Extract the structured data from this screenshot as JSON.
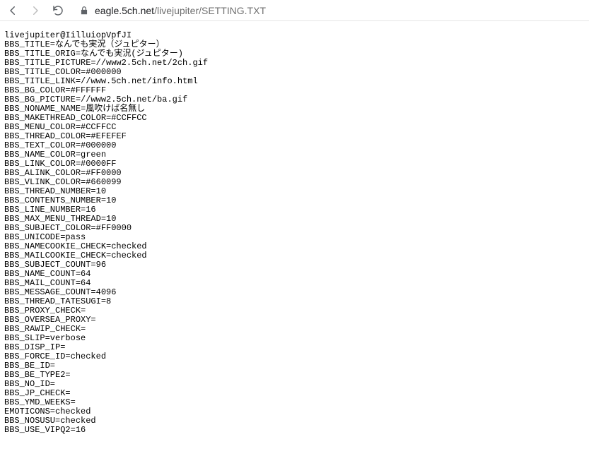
{
  "browser": {
    "url_host": "eagle.5ch.net",
    "url_path": "/livejupiter/SETTING.TXT"
  },
  "lines": [
    "livejupiter@IilluiopVpfJI",
    "BBS_TITLE=なんでも実況（ジュピター）",
    "BBS_TITLE_ORIG=なんでも実況(ジュピター)",
    "BBS_TITLE_PICTURE=//www2.5ch.net/2ch.gif",
    "BBS_TITLE_COLOR=#000000",
    "BBS_TITLE_LINK=//www.5ch.net/info.html",
    "BBS_BG_COLOR=#FFFFFF",
    "BBS_BG_PICTURE=//www2.5ch.net/ba.gif",
    "BBS_NONAME_NAME=風吹けば名無し",
    "BBS_MAKETHREAD_COLOR=#CCFFCC",
    "BBS_MENU_COLOR=#CCFFCC",
    "BBS_THREAD_COLOR=#EFEFEF",
    "BBS_TEXT_COLOR=#000000",
    "BBS_NAME_COLOR=green",
    "BBS_LINK_COLOR=#0000FF",
    "BBS_ALINK_COLOR=#FF0000",
    "BBS_VLINK_COLOR=#660099",
    "BBS_THREAD_NUMBER=10",
    "BBS_CONTENTS_NUMBER=10",
    "BBS_LINE_NUMBER=16",
    "BBS_MAX_MENU_THREAD=10",
    "BBS_SUBJECT_COLOR=#FF0000",
    "BBS_UNICODE=pass",
    "BBS_NAMECOOKIE_CHECK=checked",
    "BBS_MAILCOOKIE_CHECK=checked",
    "BBS_SUBJECT_COUNT=96",
    "BBS_NAME_COUNT=64",
    "BBS_MAIL_COUNT=64",
    "BBS_MESSAGE_COUNT=4096",
    "BBS_THREAD_TATESUGI=8",
    "BBS_PROXY_CHECK=",
    "BBS_OVERSEA_PROXY=",
    "BBS_RAWIP_CHECK=",
    "BBS_SLIP=verbose",
    "BBS_DISP_IP=",
    "BBS_FORCE_ID=checked",
    "BBS_BE_ID=",
    "BBS_BE_TYPE2=",
    "BBS_NO_ID=",
    "BBS_JP_CHECK=",
    "BBS_YMD_WEEKS=",
    "EMOTICONS=checked",
    "BBS_NOSUSU=checked",
    "BBS_USE_VIPQ2=16"
  ]
}
